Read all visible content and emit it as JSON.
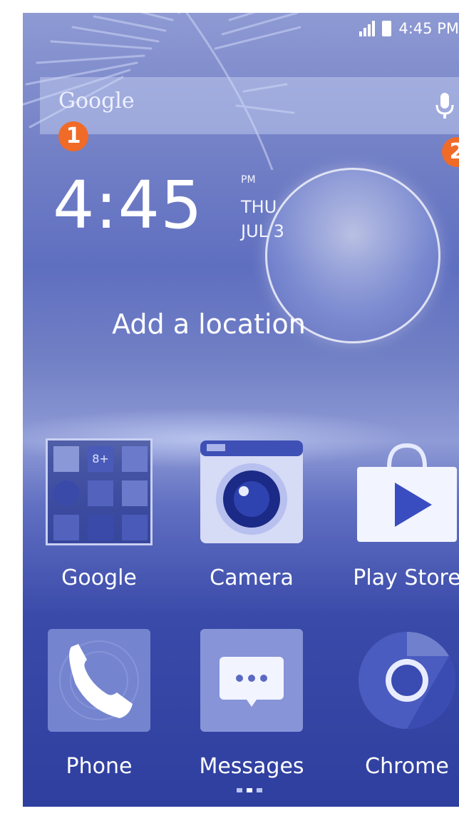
{
  "status_bar": {
    "time": "4:45 PM"
  },
  "search": {
    "logo": "Google",
    "badge_left": "1",
    "badge_right": "2"
  },
  "clock_widget": {
    "time": "4:45",
    "ampm": "PM",
    "day": "THU",
    "date": "JUL 3",
    "location": "Add a location"
  },
  "apps_row1": [
    {
      "label": "Google",
      "icon": "google-folder-icon"
    },
    {
      "label": "Camera",
      "icon": "camera-icon"
    },
    {
      "label": "Play Store",
      "icon": "play-store-icon"
    }
  ],
  "apps_row2": [
    {
      "label": "Phone",
      "icon": "phone-icon"
    },
    {
      "label": "Messages",
      "icon": "messages-icon"
    },
    {
      "label": "Chrome",
      "icon": "chrome-icon"
    }
  ],
  "page_indicator": {
    "pages": 3,
    "active": 2
  }
}
